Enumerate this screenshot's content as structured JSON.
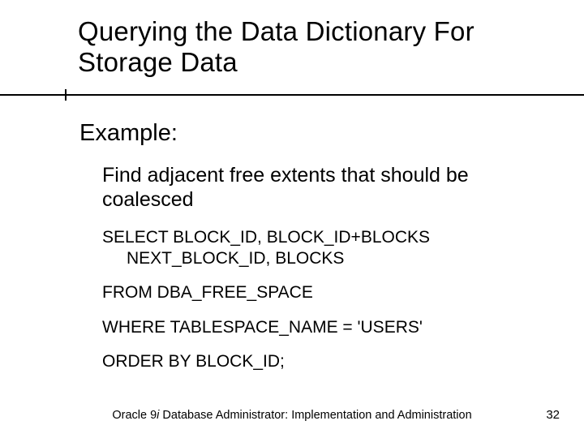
{
  "title_line1": "Querying the Data Dictionary For",
  "title_line2": "Storage Data",
  "subhead": "Example:",
  "para1": "Find adjacent free extents that should be coalesced",
  "sql": {
    "select_l1": "SELECT BLOCK_ID, BLOCK_ID+BLOCKS",
    "select_l2": "NEXT_BLOCK_ID, BLOCKS",
    "from": "FROM DBA_FREE_SPACE",
    "where": "WHERE TABLESPACE_NAME = 'USERS'",
    "order": "ORDER BY BLOCK_ID;"
  },
  "footer_prefix": "Oracle 9",
  "footer_italic": "i",
  "footer_rest": " Database Administrator: Implementation and Administration",
  "page": "32"
}
